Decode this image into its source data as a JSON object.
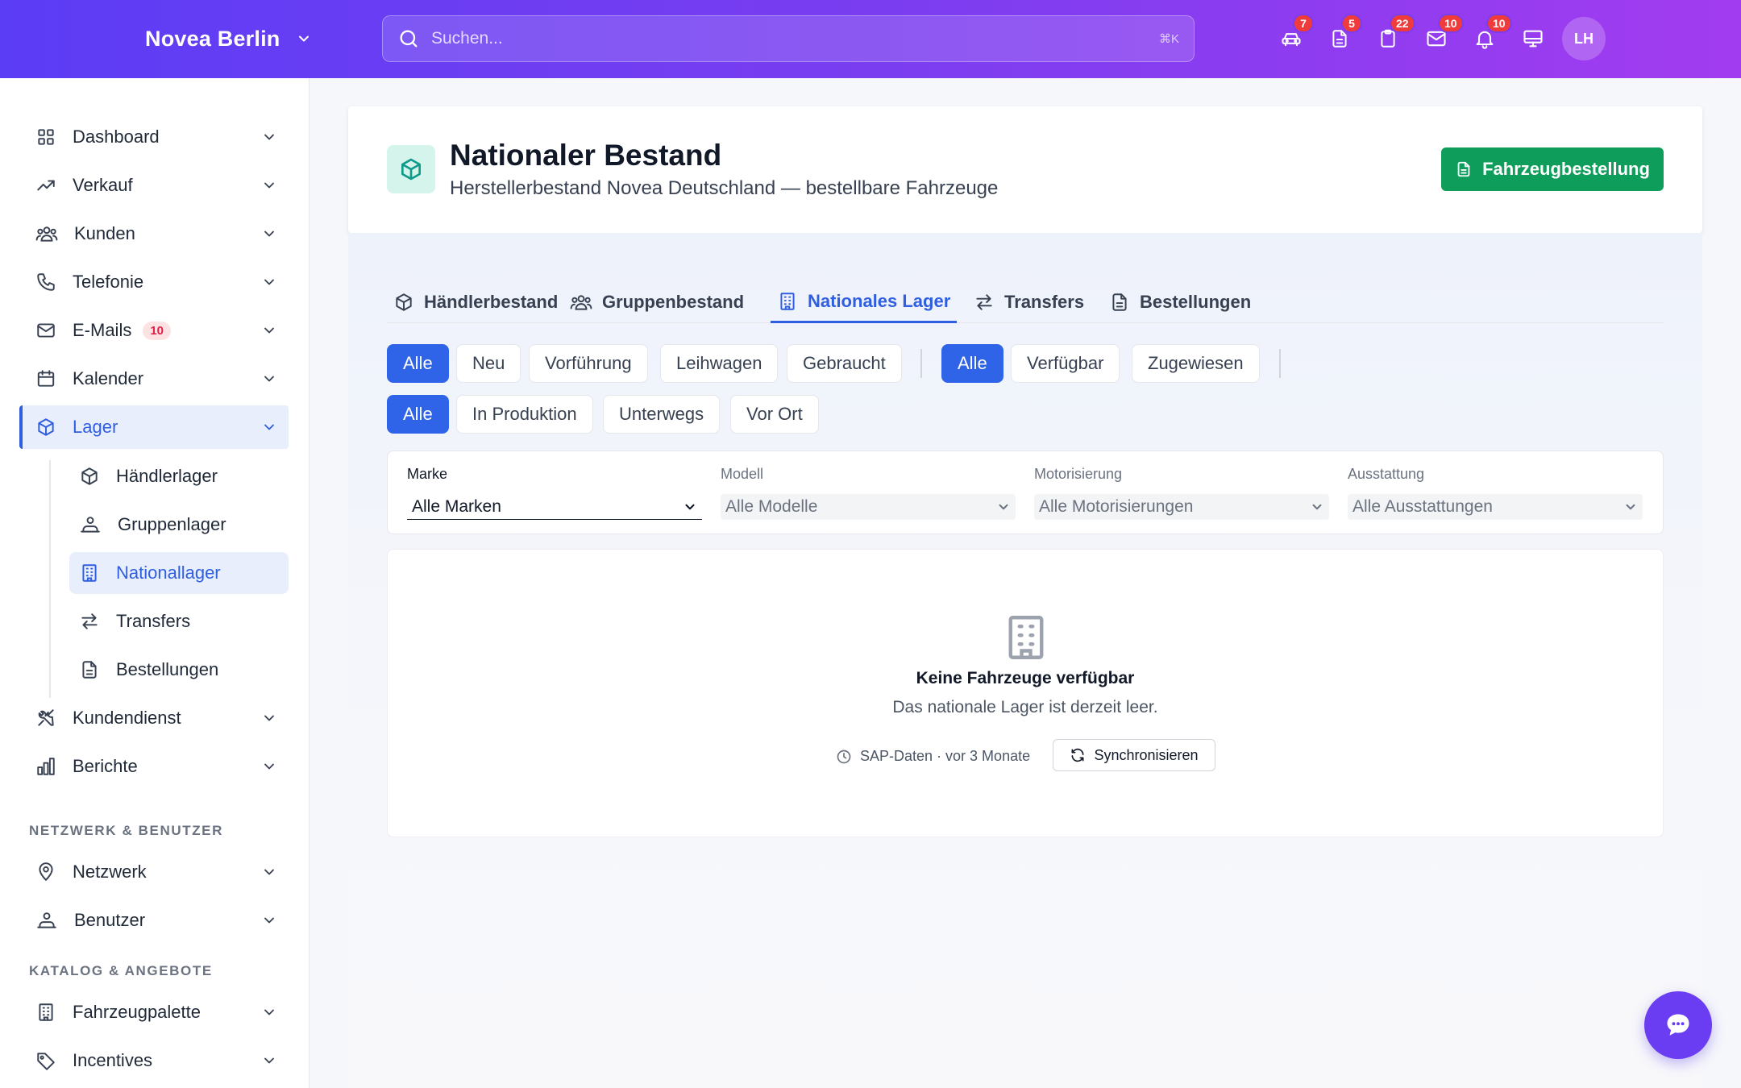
{
  "topbar": {
    "brand": "Novea Berlin",
    "search_placeholder": "Suchen...",
    "search_shortcut": "⌘K",
    "icons": [
      {
        "icon": "car-icon",
        "badge": "7"
      },
      {
        "icon": "document-icon",
        "badge": "5"
      },
      {
        "icon": "clipboard-icon",
        "badge": "22"
      },
      {
        "icon": "mail-icon",
        "badge": "10"
      },
      {
        "icon": "bell-icon",
        "badge": "10"
      },
      {
        "icon": "monitor-icon",
        "badge": ""
      }
    ],
    "avatar_initials": "LH"
  },
  "sidebar": {
    "items": [
      {
        "label": "Dashboard",
        "icon": "grid-icon"
      },
      {
        "label": "Verkauf",
        "icon": "trend-up-icon"
      },
      {
        "label": "Kunden",
        "icon": "users-icon"
      },
      {
        "label": "Telefonie",
        "icon": "phone-icon"
      },
      {
        "label": "E-Mails",
        "icon": "mail-icon",
        "badge": "10"
      },
      {
        "label": "Kalender",
        "icon": "calendar-icon"
      },
      {
        "label": "Lager",
        "icon": "box-icon",
        "active": true
      }
    ],
    "sub_items": [
      {
        "label": "Händlerlager",
        "icon": "box-icon"
      },
      {
        "label": "Gruppenlager",
        "icon": "user-group-icon"
      },
      {
        "label": "Nationallager",
        "icon": "building-icon",
        "active": true
      },
      {
        "label": "Transfers",
        "icon": "arrows-icon"
      },
      {
        "label": "Bestellungen",
        "icon": "document-icon"
      }
    ],
    "items_after": [
      {
        "label": "Kundendienst",
        "icon": "tools-icon"
      },
      {
        "label": "Berichte",
        "icon": "chart-icon"
      }
    ],
    "section_network": "NETZWERK & BENUTZER",
    "network_items": [
      {
        "label": "Netzwerk",
        "icon": "location-icon"
      },
      {
        "label": "Benutzer",
        "icon": "user-group-icon"
      }
    ],
    "section_catalog": "KATALOG & ANGEBOTE",
    "catalog_items": [
      {
        "label": "Fahrzeugpalette",
        "icon": "building-icon"
      },
      {
        "label": "Incentives",
        "icon": "tag-icon"
      }
    ]
  },
  "header": {
    "title": "Nationaler Bestand",
    "subtitle": "Herstellerbestand Novea Deutschland — bestellbare Fahrzeuge",
    "order_button": "Fahrzeugbestellung"
  },
  "tabs": [
    {
      "label": "Händlerbestand",
      "icon": "box-icon"
    },
    {
      "label": "Gruppenbestand",
      "icon": "users-icon"
    },
    {
      "label": "Nationales Lager",
      "icon": "building-icon",
      "active": true
    },
    {
      "label": "Transfers",
      "icon": "arrows-icon"
    },
    {
      "label": "Bestellungen",
      "icon": "document-icon"
    }
  ],
  "filters": {
    "type": [
      "Alle",
      "Neu",
      "Vorführung",
      "Leihwagen",
      "Gebraucht"
    ],
    "availability": [
      "Alle",
      "Verfügbar",
      "Zugewiesen"
    ],
    "status": [
      "Alle",
      "In Produktion",
      "Unterwegs",
      "Vor Ort"
    ],
    "selects": [
      {
        "label": "Marke",
        "value": "Alle Marken"
      },
      {
        "label": "Modell",
        "value": "Alle Modelle"
      },
      {
        "label": "Motorisierung",
        "value": "Alle Motorisierungen"
      },
      {
        "label": "Ausstattung",
        "value": "Alle Ausstattungen"
      }
    ]
  },
  "empty_state": {
    "title": "Keine Fahrzeuge verfügbar",
    "subtitle": "Das nationale Lager ist derzeit leer.",
    "sap_info": "SAP-Daten · vor 3 Monate",
    "sync_button": "Synchronisieren"
  },
  "colors": {
    "accent": "#2f64e9",
    "success": "#0f9d5c",
    "brand_gradient_start": "#5b3df5",
    "brand_gradient_end": "#a23cf0"
  }
}
